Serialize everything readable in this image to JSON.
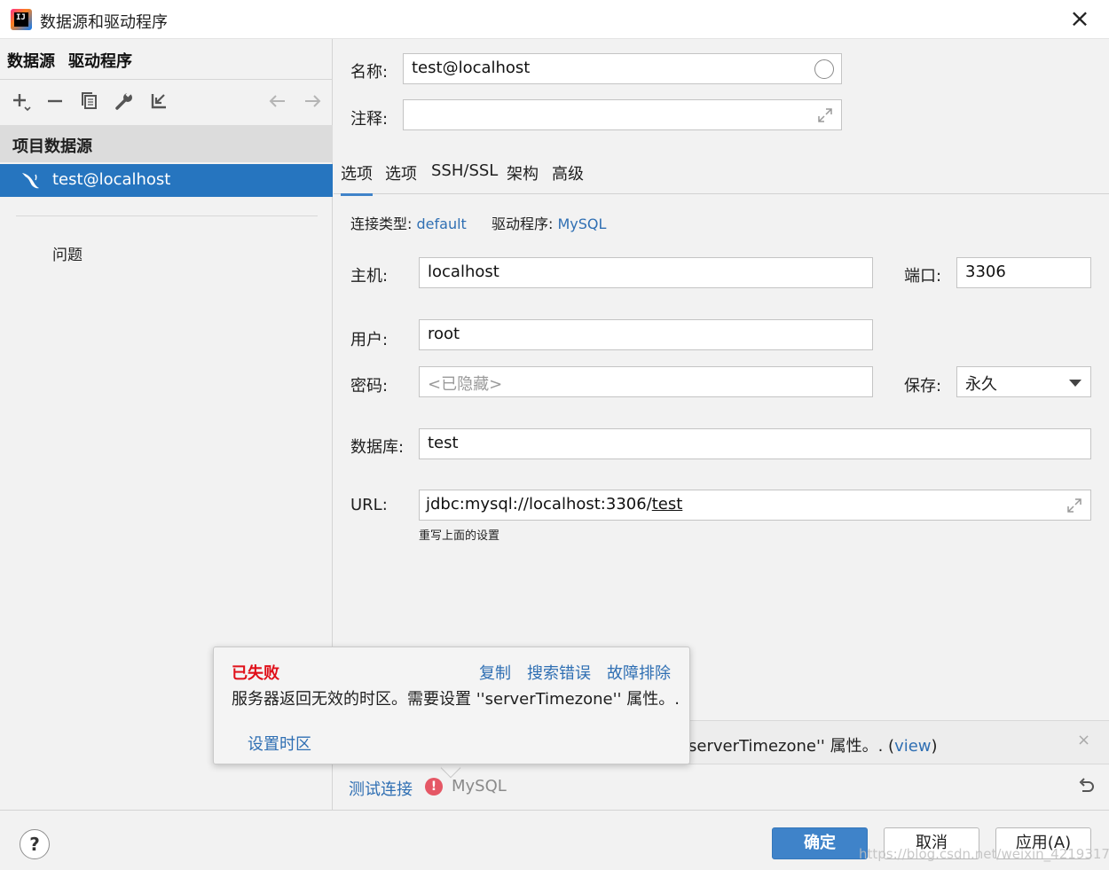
{
  "window": {
    "title": "数据源和驱动程序",
    "app_icon_letters": "IJ"
  },
  "left": {
    "tabs": [
      "数据源",
      "驱动程序"
    ],
    "toolbar": {
      "add": "+",
      "remove": "−",
      "copy": "⧉",
      "settings": "🔧",
      "import": "⇲",
      "back": "←",
      "forward": "→"
    },
    "section_title": "项目数据源",
    "datasource": "test@localhost",
    "problems": "问题"
  },
  "form": {
    "name_label": "名称:",
    "name_value": "test@localhost",
    "comment_label": "注释:",
    "comment_value": "",
    "tabs": [
      "选项",
      "选项",
      "SSH/SSL",
      "架构",
      "高级"
    ],
    "conn_type_label": "连接类型:",
    "conn_type_value": "default",
    "driver_label": "驱动程序:",
    "driver_value": "MySQL",
    "host_label": "主机:",
    "host_value": "localhost",
    "port_label": "端口:",
    "port_value": "3306",
    "user_label": "用户:",
    "user_value": "root",
    "password_label": "密码:",
    "password_placeholder": "<已隐藏>",
    "save_label": "保存:",
    "save_value": "永久",
    "database_label": "数据库:",
    "database_value": "test",
    "url_label": "URL:",
    "url_prefix": "jdbc:mysql://localhost:3306/",
    "url_db": "test",
    "url_hint": "重写上面的设置"
  },
  "status": {
    "text_main": "serverTimezone'' 属性。. (",
    "text_link": "view",
    "text_end": ")",
    "close": "×"
  },
  "test": {
    "link": "测试连接",
    "driver": "MySQL"
  },
  "popup": {
    "title": "已失败",
    "actions": [
      "复制",
      "搜索错误",
      "故障排除"
    ],
    "message": "服务器返回无效的时区。需要设置 ''serverTimezone'' 属性。.",
    "fix_link": "设置时区"
  },
  "footer": {
    "help": "?",
    "ok": "确定",
    "cancel": "取消",
    "apply": "应用(A)",
    "watermark": "https://blog.csdn.net/weixin_42193173"
  },
  "colors": {
    "accent": "#2675bf",
    "link": "#2f6fb3",
    "error": "#e0101a"
  }
}
